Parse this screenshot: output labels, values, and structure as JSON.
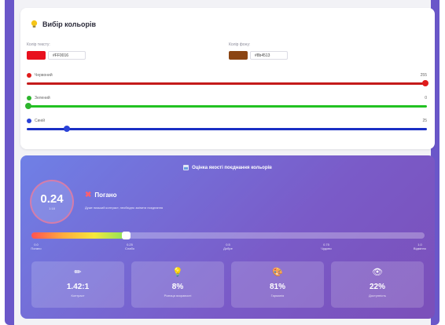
{
  "color_picker": {
    "title": "Вибір кольорів",
    "text_label": "Колір тексту:",
    "text_hex": "#FF0016",
    "text_color": "#e8101e",
    "bg_label": "Колір фону:",
    "bg_hex": "#8b4513",
    "bg_color": "#8b4513"
  },
  "sliders": [
    {
      "label": "Червоний",
      "value": "255",
      "fraction": 1.0,
      "color": "#e01b1b",
      "track": "#c41a1a"
    },
    {
      "label": "Зелений",
      "value": "0",
      "fraction": 0.0,
      "color": "#2db52d",
      "track": "#22c222"
    },
    {
      "label": "Синій",
      "value": "25",
      "fraction": 0.098,
      "color": "#2a42d8",
      "track": "#1a2fc4"
    }
  ],
  "result": {
    "title": "Оцінка якості поєднання кольорів",
    "ratio": "0.24",
    "ratio_sub": "1:18",
    "verdict": "Погано",
    "verdict_note": "Дуже низький контраст, необхідно змінити поєднання",
    "scale_fraction": 0.24,
    "ticks": [
      {
        "value": "0.0",
        "label": "Погано",
        "pos": 0.0
      },
      {
        "value": "0.25",
        "label": "Слабо",
        "pos": 0.25
      },
      {
        "value": "0.5",
        "label": "Добре",
        "pos": 0.5
      },
      {
        "value": "0.75",
        "label": "Чудово",
        "pos": 0.75
      },
      {
        "value": "1.0",
        "label": "Відмінно",
        "pos": 1.0
      }
    ]
  },
  "metrics": [
    {
      "icon": "pencil-icon",
      "glyph": "✏",
      "value": "1.42:1",
      "label": "Контраст"
    },
    {
      "icon": "lightbulb-icon",
      "glyph": "💡",
      "value": "8%",
      "label": "Різниця яскравості"
    },
    {
      "icon": "palette-icon",
      "glyph": "🎨",
      "value": "81%",
      "label": "Гармонія"
    },
    {
      "icon": "eye-icon",
      "glyph": "👁",
      "value": "22%",
      "label": "Доступність"
    }
  ]
}
